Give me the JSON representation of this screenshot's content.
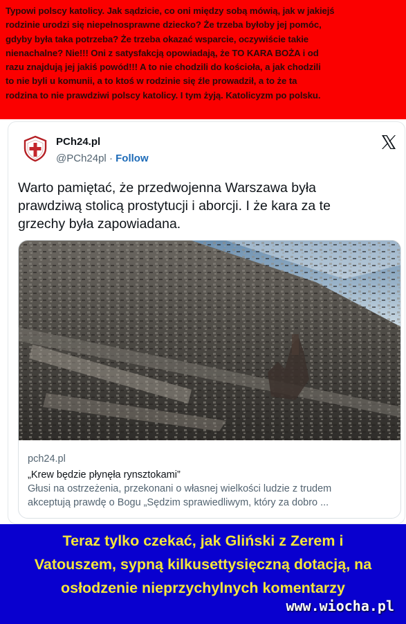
{
  "top_banner": {
    "lines": [
      "Typowi polscy katolicy. Jak sądzicie, co oni między sobą mówią, jak w jakiejś",
      "rodzinie urodzi się niepełnosprawne dziecko? Że trzeba byłoby jej pomóc,",
      "gdyby była taka potrzeba? Że trzeba okazać wsparcie, oczywiście takie",
      "nienachalne? Nie!!! Oni z satysfakcją opowiadają, że TO KARA BOŻA i od",
      "razu znajdują jej jakiś powód!!! A to nie chodzili do kościoła, a jak chodzili",
      "to nie byli u komunii, a to ktoś w rodzinie się źle prowadził, a to że ta",
      "rodzina to nie prawdziwi polscy katolicy. I tym żyją. Katolicyzm po polsku."
    ],
    "background": "#fb0000"
  },
  "tweet": {
    "author_name": "PCh24.pl",
    "handle": "@PCh24pl",
    "separator": " · ",
    "follow_label": "Follow",
    "text_lines": [
      "Warto pamiętać, że przedwojenna Warszawa była",
      "prawdziwą stolicą prostytucji i aborcji. I że kara za te",
      "grzechy była zapowiadana."
    ],
    "link_card": {
      "domain": "pch24.pl",
      "title": "„Krew będzie płynęła rynsztokami”",
      "description_lines": [
        "Głusi na ostrzeżenia, przekonani o własnej wielkości ludzie z trudem",
        "akceptują prawdę o Bogu „Sędzim sprawiedliwym, który za dobro ..."
      ]
    }
  },
  "bottom_banner": {
    "lines": [
      "Teraz tylko czekać, jak Gliński z Zerem i",
      "Vatouszem, sypną  kilkusettysięczną dotacją, na",
      "osłodzenie nieprzychylnych komentarzy"
    ],
    "watermark": "www.wiocha.pl",
    "background": "#0900cf",
    "text_color": "#f5e63a"
  },
  "icons": {
    "avatar": "shield-cross-logo-icon",
    "platform": "x-logo-icon"
  }
}
